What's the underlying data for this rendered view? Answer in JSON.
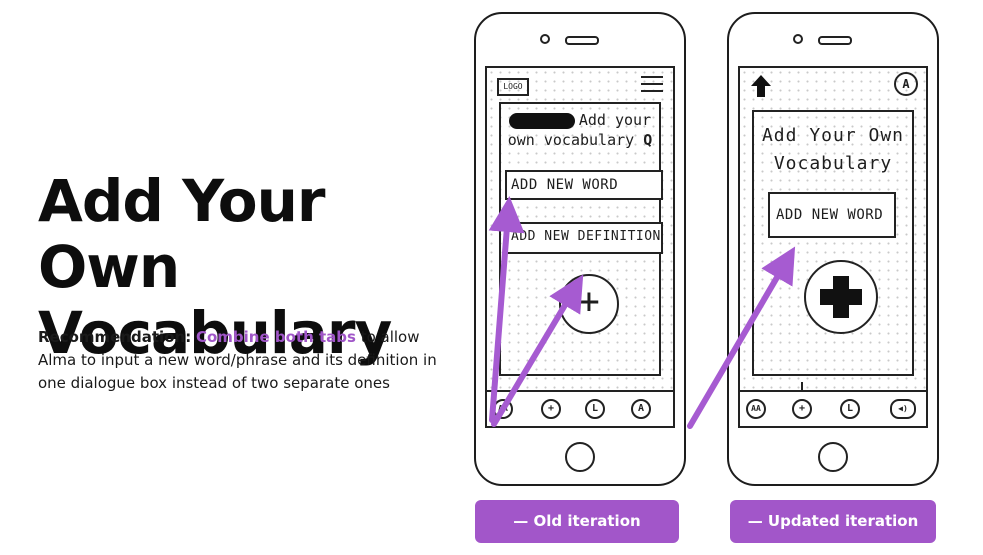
{
  "heading": {
    "line1": "Add Your Own",
    "line2": "Vocabulary"
  },
  "recommendation": {
    "label": "Recommendation:",
    "highlight": "Combine both tabs",
    "rest": " to allow Alma to input a new word/phrase and its definition in one dialogue box instead of two separate ones"
  },
  "old_screen": {
    "logo": "LOGO",
    "title_line1": "Add your",
    "title_line2": "own vocabulary",
    "search_glyph": "Q",
    "field_word": "ADD NEW WORD",
    "field_definition": "ADD NEW DEFINITION",
    "plus_glyph": "+",
    "pager": "●○○○○",
    "tab_labels": [
      "AA",
      "+",
      "L",
      "A"
    ]
  },
  "new_screen": {
    "profile_glyph": "A",
    "title_line1": "Add Your Own",
    "title_line2": "Vocabulary",
    "field_word": "ADD NEW WORD",
    "plus_glyph": "+",
    "tab_labels": [
      "AA",
      "+",
      "L",
      "◀)"
    ]
  },
  "captions": {
    "old": "— Old iteration",
    "updated": "— Updated iteration"
  },
  "colors": {
    "accent": "#a256c9",
    "arrow": "#a65bd1"
  }
}
